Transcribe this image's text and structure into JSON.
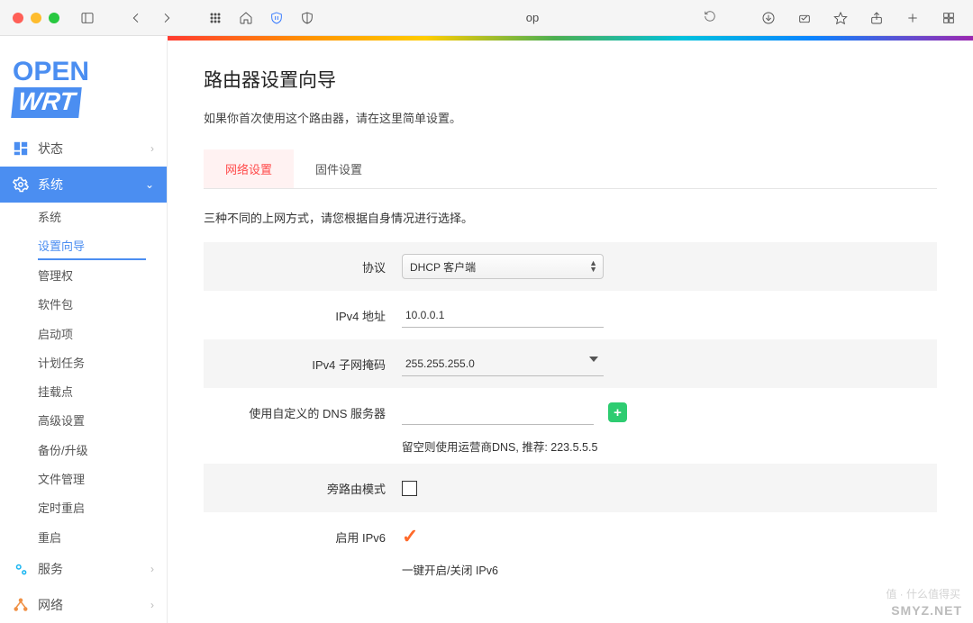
{
  "browser": {
    "url_display": "op"
  },
  "logo": {
    "part1": "OPEN",
    "part2": "WRT"
  },
  "sidebar": {
    "status": "状态",
    "system": "系统",
    "system_children": [
      "系统",
      "设置向导",
      "管理权",
      "软件包",
      "启动项",
      "计划任务",
      "挂载点",
      "高级设置",
      "备份/升级",
      "文件管理",
      "定时重启",
      "重启"
    ],
    "services": "服务",
    "network": "网络"
  },
  "page": {
    "title": "路由器设置向导",
    "subtitle": "如果你首次使用这个路由器，请在这里简单设置。"
  },
  "tabs": {
    "t1": "网络设置",
    "t2": "固件设置"
  },
  "form": {
    "desc": "三种不同的上网方式，请您根据自身情况进行选择。",
    "protocol_label": "协议",
    "protocol_value": "DHCP 客户端",
    "ipv4_addr_label": "IPv4 地址",
    "ipv4_addr_value": "10.0.0.1",
    "ipv4_mask_label": "IPv4 子网掩码",
    "ipv4_mask_value": "255.255.255.0",
    "dns_label": "使用自定义的 DNS 服务器",
    "dns_hint": "留空则使用运营商DNS, 推荐: 223.5.5.5",
    "bypass_label": "旁路由模式",
    "ipv6_label": "启用 IPv6",
    "ipv6_hint": "一键开启/关闭 IPv6"
  },
  "watermark": {
    "w1": "值 · 什么值得买",
    "w2": "SMYZ.NET"
  }
}
